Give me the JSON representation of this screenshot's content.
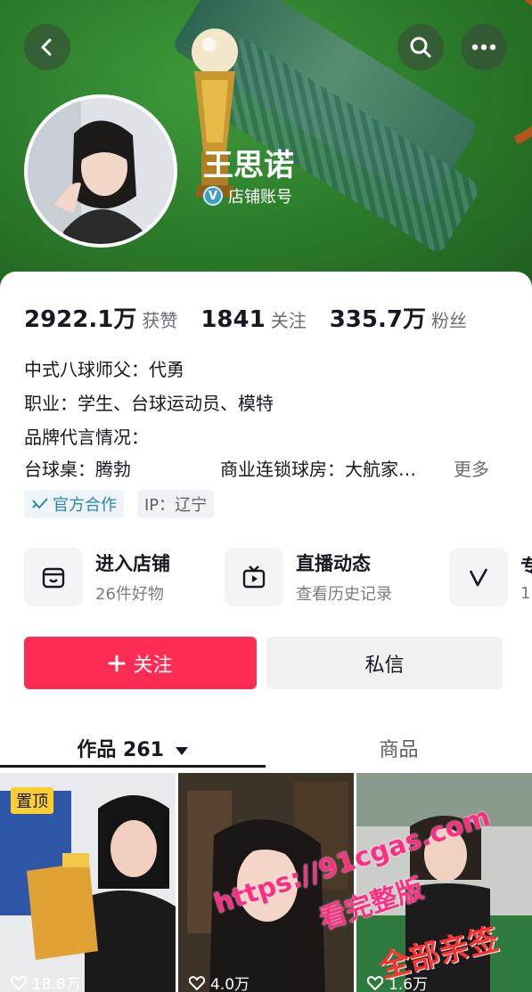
{
  "header": {
    "nickname": "王思诺",
    "account_type": "店铺账号",
    "verified_mark": "V",
    "icons": [
      "back-icon",
      "search-icon",
      "more-icon"
    ]
  },
  "stats": [
    {
      "value": "2922.1万",
      "label": "获赞"
    },
    {
      "value": "1841",
      "label": "关注"
    },
    {
      "value": "335.7万",
      "label": "粉丝"
    }
  ],
  "bio": {
    "line1": "中式八球师父：代勇",
    "line2": "职业：学生、台球运动员、模特",
    "line3": "品牌代言情况：",
    "line4a": "台球桌：腾勃",
    "line4b": "商业连锁球房：大航家…",
    "more": "更多"
  },
  "tags": {
    "official": "官方合作",
    "ip": "IP：辽宁"
  },
  "services": [
    {
      "title": "进入店铺",
      "sub": "26件好物",
      "icon": "store-icon"
    },
    {
      "title": "直播动态",
      "sub": "查看历史记录",
      "icon": "tv-icon"
    },
    {
      "title": "专",
      "sub": "1",
      "icon": "v-icon"
    }
  ],
  "actions": {
    "follow": "关注",
    "message": "私信"
  },
  "tabs": {
    "works": "作品 261",
    "goods": "商品"
  },
  "videos": [
    {
      "pin": "置顶",
      "plays": "18.8万"
    },
    {
      "plays": "4.0万"
    },
    {
      "plays": "1.6万"
    }
  ],
  "watermarks": {
    "url": "https://91cgas.com",
    "text2": "看完整版",
    "text3": "全部亲签"
  },
  "colors": {
    "accent": "#fe2c55",
    "banner": "#2d7f2c",
    "official_tag": "#2a84b8",
    "pin": "#fbcf30"
  }
}
